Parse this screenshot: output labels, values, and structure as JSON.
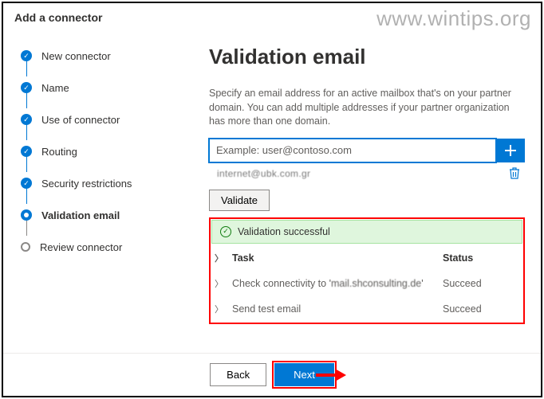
{
  "watermark": "www.wintips.org",
  "header": "Add a connector",
  "steps": [
    {
      "label": "New connector",
      "state": "done"
    },
    {
      "label": "Name",
      "state": "done"
    },
    {
      "label": "Use of connector",
      "state": "done"
    },
    {
      "label": "Routing",
      "state": "done"
    },
    {
      "label": "Security restrictions",
      "state": "done"
    },
    {
      "label": "Validation email",
      "state": "current"
    },
    {
      "label": "Review connector",
      "state": "pending"
    }
  ],
  "main": {
    "title": "Validation email",
    "description": "Specify an email address for an active mailbox that's on your partner domain. You can add multiple addresses if your partner organization has more than one domain.",
    "placeholder": "Example: user@contoso.com",
    "added_email": "internet@ubk.com.gr",
    "validate_label": "Validate",
    "success_message": "Validation successful",
    "table": {
      "task_header": "Task",
      "status_header": "Status",
      "rows": [
        {
          "task": "Check connectivity to 'mail.shconsulting.de'",
          "status": "Succeed"
        },
        {
          "task": "Send test email",
          "status": "Succeed"
        }
      ]
    }
  },
  "footer": {
    "back": "Back",
    "next": "Next"
  }
}
